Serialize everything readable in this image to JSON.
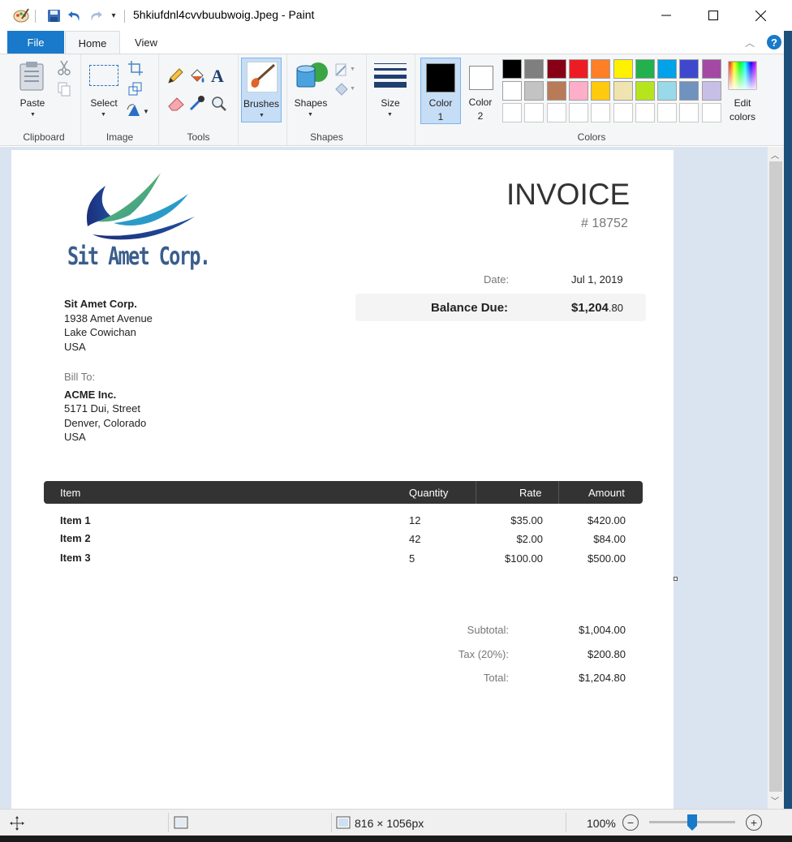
{
  "window": {
    "title": "5hkiufdnl4cvvbuubwoig.Jpeg - Paint"
  },
  "tabs": {
    "file": "File",
    "home": "Home",
    "view": "View"
  },
  "ribbon": {
    "clipboard": {
      "paste": "Paste",
      "group": "Clipboard"
    },
    "image": {
      "select": "Select",
      "group": "Image"
    },
    "tools": {
      "group": "Tools"
    },
    "brushes": {
      "label": "Brushes"
    },
    "shapes": {
      "label": "Shapes",
      "group": "Shapes"
    },
    "size": {
      "label": "Size"
    },
    "color1": {
      "line1": "Color",
      "line2": "1"
    },
    "color2": {
      "line1": "Color",
      "line2": "2"
    },
    "colors": {
      "group": "Colors",
      "edit_line1": "Edit",
      "edit_line2": "colors",
      "row1": [
        "#000000",
        "#7f7f7f",
        "#880015",
        "#ed1c24",
        "#ff7f27",
        "#fff200",
        "#22b14c",
        "#00a2e8",
        "#3f48cc",
        "#a349a4"
      ],
      "row2": [
        "#ffffff",
        "#c3c3c3",
        "#b97a57",
        "#ffaec9",
        "#ffc90e",
        "#efe4b0",
        "#b5e61d",
        "#99d9ea",
        "#7092be",
        "#c8bfe7"
      ]
    }
  },
  "status": {
    "dimensions": "816 × 1056px",
    "zoom": "100%",
    "zoom_level": 0.5
  },
  "invoice": {
    "logo_text": "Sit Amet Corp.",
    "heading": "INVOICE",
    "number": "# 18752",
    "date_label": "Date:",
    "date_value": "Jul 1, 2019",
    "balance_label": "Balance Due:",
    "balance_main": "$1,204",
    "balance_cents": ".80",
    "from": {
      "name": "Sit Amet Corp.",
      "line1": "1938 Amet Avenue",
      "line2": "Lake Cowichan",
      "line3": "USA"
    },
    "bill_to_label": "Bill To:",
    "to": {
      "name": "ACME Inc.",
      "line1": "5171 Dui, Street",
      "line2": "Denver, Colorado",
      "line3": "USA"
    },
    "columns": {
      "item": "Item",
      "quantity": "Quantity",
      "rate": "Rate",
      "amount": "Amount"
    },
    "rows": [
      {
        "item": "Item 1",
        "quantity": "12",
        "rate": "$35.00",
        "amount": "$420.00"
      },
      {
        "item": "Item 2",
        "quantity": "42",
        "rate": "$2.00",
        "amount": "$84.00"
      },
      {
        "item": "Item 3",
        "quantity": "5",
        "rate": "$100.00",
        "amount": "$500.00"
      }
    ],
    "subtotal_label": "Subtotal:",
    "subtotal_value": "$1,004.00",
    "tax_label": "Tax (20%):",
    "tax_value": "$200.80",
    "total_label": "Total:",
    "total_value": "$1,204.80"
  }
}
